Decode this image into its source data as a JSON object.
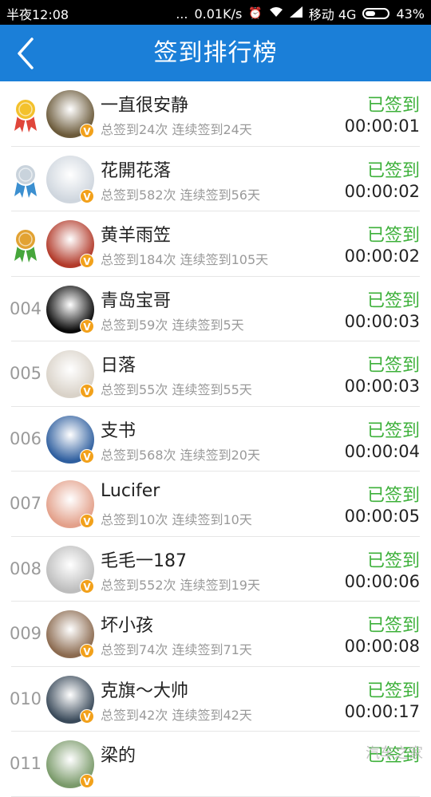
{
  "status_bar": {
    "time": "半夜12:08",
    "dots": "...",
    "speed": "0.01K/s",
    "carrier": "移动 4G",
    "battery": "43%",
    "battery_level": 0.43
  },
  "header": {
    "title": "签到排行榜",
    "back_icon": "chevron-left-icon"
  },
  "colors": {
    "header": "#1b7fd8",
    "signed": "#3db03a",
    "badge": "#f2a11b"
  },
  "rows": [
    {
      "rank": "",
      "medal": "gold",
      "name": "一直很安静",
      "stats": "总签到24次  连续签到24天",
      "status": "已签到",
      "time": "00:00:01",
      "avatar_color": "#6b5a3a"
    },
    {
      "rank": "",
      "medal": "silver",
      "name": "花開花落",
      "stats": "总签到582次  连续签到56天",
      "status": "已签到",
      "time": "00:00:02",
      "avatar_color": "#cfd6de"
    },
    {
      "rank": "",
      "medal": "bronze",
      "name": "黄羊雨笠",
      "stats": "总签到184次  连续签到105天",
      "status": "已签到",
      "time": "00:00:02",
      "avatar_color": "#b23a2a"
    },
    {
      "rank": "004",
      "medal": "",
      "name": "青岛宝哥",
      "stats": "总签到59次  连续签到5天",
      "status": "已签到",
      "time": "00:00:03",
      "avatar_color": "#0a0a0a"
    },
    {
      "rank": "005",
      "medal": "",
      "name": "日落",
      "stats": "总签到55次  连续签到55天",
      "status": "已签到",
      "time": "00:00:03",
      "avatar_color": "#d9d2c8"
    },
    {
      "rank": "006",
      "medal": "",
      "name": "支书",
      "stats": "总签到568次  连续签到20天",
      "status": "已签到",
      "time": "00:00:04",
      "avatar_color": "#2f5f9f"
    },
    {
      "rank": "007",
      "medal": "",
      "name": "Lucifer",
      "stats": "总签到10次  连续签到10天",
      "status": "已签到",
      "time": "00:00:05",
      "avatar_color": "#e3a08a"
    },
    {
      "rank": "008",
      "medal": "",
      "name": "毛毛一187",
      "stats": "总签到552次  连续签到19天",
      "status": "已签到",
      "time": "00:00:06",
      "avatar_color": "#bdbdbd"
    },
    {
      "rank": "009",
      "medal": "",
      "name": "坏小孩",
      "stats": "总签到74次  连续签到71天",
      "status": "已签到",
      "time": "00:00:08",
      "avatar_color": "#8b6a4f"
    },
    {
      "rank": "010",
      "medal": "",
      "name": "克旗～大帅",
      "stats": "总签到42次  连续签到42天",
      "status": "已签到",
      "time": "00:00:17",
      "avatar_color": "#3a4a5a"
    },
    {
      "rank": "011",
      "medal": "",
      "name": "梁的",
      "stats": "",
      "status": "已签到",
      "time": "",
      "avatar_color": "#7a9a6a"
    }
  ],
  "watermark": "汽车之家"
}
